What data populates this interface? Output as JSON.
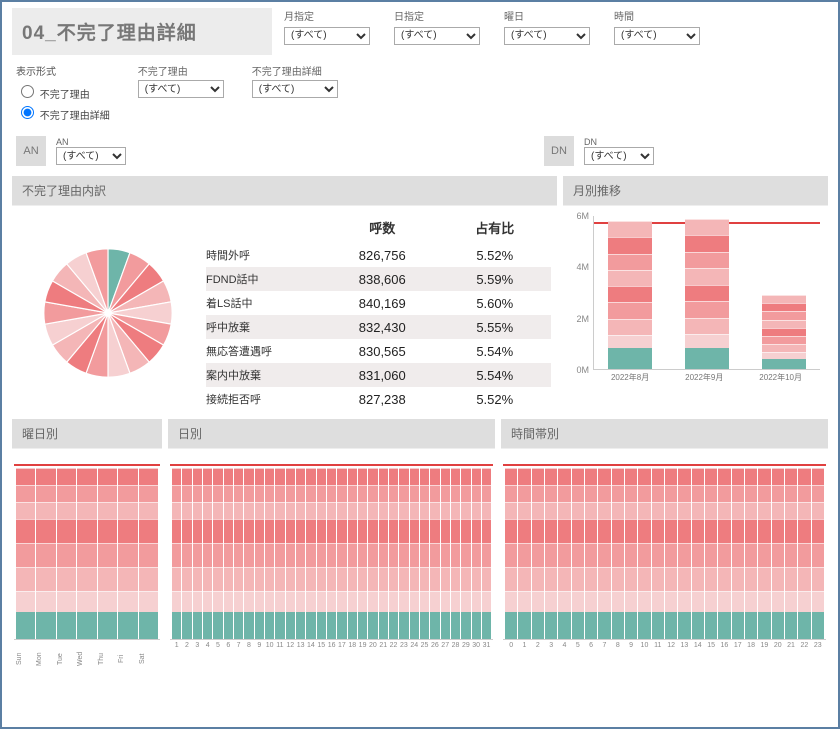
{
  "page_title": "04_不完了理由詳細",
  "filters_top": {
    "month": {
      "label": "月指定",
      "value": "(すべて)"
    },
    "day": {
      "label": "日指定",
      "value": "(すべて)"
    },
    "weekday": {
      "label": "曜日",
      "value": "(すべて)"
    },
    "hour": {
      "label": "時間",
      "value": "(すべて)"
    }
  },
  "display_mode": {
    "label": "表示形式",
    "opt1": "不完了理由",
    "opt2": "不完了理由詳細",
    "selected": "opt2"
  },
  "reason_filter": {
    "label": "不完了理由",
    "value": "(すべて)"
  },
  "reason_detail_filter": {
    "label": "不完了理由詳細",
    "value": "(すべて)"
  },
  "an": {
    "badge": "AN",
    "label": "AN",
    "value": "(すべて)"
  },
  "dn": {
    "badge": "DN",
    "label": "DN",
    "value": "(すべて)"
  },
  "breakdown_panel": {
    "title": "不完了理由内訳",
    "col_calls": "呼数",
    "col_share": "占有比",
    "rows": [
      {
        "name": "時間外呼",
        "calls": "826,756",
        "share": "5.52%"
      },
      {
        "name": "FDND話中",
        "calls": "838,606",
        "share": "5.59%"
      },
      {
        "name": "着LS話中",
        "calls": "840,169",
        "share": "5.60%"
      },
      {
        "name": "呼中放棄",
        "calls": "832,430",
        "share": "5.55%"
      },
      {
        "name": "無応答遭遇呼",
        "calls": "830,565",
        "share": "5.54%"
      },
      {
        "name": "案内中放棄",
        "calls": "831,060",
        "share": "5.54%"
      },
      {
        "name": "接続拒否呼",
        "calls": "827,238",
        "share": "5.52%"
      }
    ]
  },
  "monthly_panel": {
    "title": "月別推移",
    "yticks": [
      "0M",
      "2M",
      "4M",
      "6M"
    ],
    "categories": [
      "2022年8月",
      "2022年9月",
      "2022年10月"
    ]
  },
  "weekday_panel": {
    "title": "曜日別",
    "labels": [
      "Sun",
      "Mon",
      "Tue",
      "Wed",
      "Thu",
      "Fri",
      "Sat"
    ]
  },
  "daily_panel": {
    "title": "日別"
  },
  "hourly_panel": {
    "title": "時間帯別"
  },
  "chart_data": [
    {
      "id": "breakdown_pie",
      "type": "pie",
      "title": "不完了理由内訳",
      "series": [
        {
          "name": "時間外呼",
          "value": 826756,
          "share_pct": 5.52,
          "color": "teal"
        },
        {
          "name": "FDND話中",
          "value": 838606,
          "share_pct": 5.59,
          "color": "pink"
        },
        {
          "name": "着LS話中",
          "value": 840169,
          "share_pct": 5.6,
          "color": "pink"
        },
        {
          "name": "呼中放棄",
          "value": 832430,
          "share_pct": 5.55,
          "color": "pink"
        },
        {
          "name": "無応答遭遇呼",
          "value": 830565,
          "share_pct": 5.54,
          "color": "pink"
        },
        {
          "name": "案内中放棄",
          "value": 831060,
          "share_pct": 5.54,
          "color": "pink"
        },
        {
          "name": "接続拒否呼",
          "value": 827238,
          "share_pct": 5.52,
          "color": "pink"
        }
      ],
      "note": "Only 7 of ~18 equal slices are labeled in the visible table; remaining ~11 slices unnamed in screenshot, each approx 5.5% share (pink shades)."
    },
    {
      "id": "monthly_trend",
      "type": "bar",
      "title": "月別推移",
      "ylabel": "呼数",
      "ylim": [
        0,
        6000000
      ],
      "categories": [
        "2022年8月",
        "2022年9月",
        "2022年10月"
      ],
      "values": [
        5800000,
        5900000,
        2900000
      ],
      "overlay_line": [
        6000000,
        6000000,
        6000000
      ],
      "stacked": true,
      "stack_note": "Each bar is stacked by ~18 reason categories of roughly equal height; bottom segment (teal) followed by pink shades."
    },
    {
      "id": "by_weekday",
      "type": "bar",
      "title": "曜日別",
      "categories": [
        "Sun",
        "Mon",
        "Tue",
        "Wed",
        "Thu",
        "Fri",
        "Sat"
      ],
      "values": [
        100,
        100,
        100,
        100,
        100,
        100,
        100
      ],
      "unit": "relative (bars approximately equal height)",
      "overlay_line": "near top, roughly flat",
      "stacked": true
    },
    {
      "id": "by_day",
      "type": "bar",
      "title": "日別",
      "categories": [
        1,
        2,
        3,
        4,
        5,
        6,
        7,
        8,
        9,
        10,
        11,
        12,
        13,
        14,
        15,
        16,
        17,
        18,
        19,
        20,
        21,
        22,
        23,
        24,
        25,
        26,
        27,
        28,
        29,
        30,
        31
      ],
      "values": [
        100,
        100,
        100,
        100,
        100,
        100,
        100,
        100,
        100,
        100,
        100,
        100,
        100,
        100,
        100,
        100,
        100,
        100,
        100,
        100,
        100,
        100,
        100,
        100,
        100,
        100,
        100,
        100,
        100,
        100,
        100
      ],
      "unit": "relative (bars approximately equal height)",
      "overlay_line": "near top, roughly flat",
      "stacked": true
    },
    {
      "id": "by_hour",
      "type": "bar",
      "title": "時間帯別",
      "categories": [
        0,
        1,
        2,
        3,
        4,
        5,
        6,
        7,
        8,
        9,
        10,
        11,
        12,
        13,
        14,
        15,
        16,
        17,
        18,
        19,
        20,
        21,
        22,
        23
      ],
      "values": [
        100,
        100,
        100,
        100,
        100,
        100,
        100,
        100,
        100,
        100,
        100,
        100,
        100,
        100,
        100,
        100,
        100,
        100,
        100,
        100,
        100,
        100,
        100,
        100
      ],
      "unit": "relative (bars approximately equal height)",
      "overlay_line": "near top, roughly flat",
      "stacked": true
    }
  ]
}
